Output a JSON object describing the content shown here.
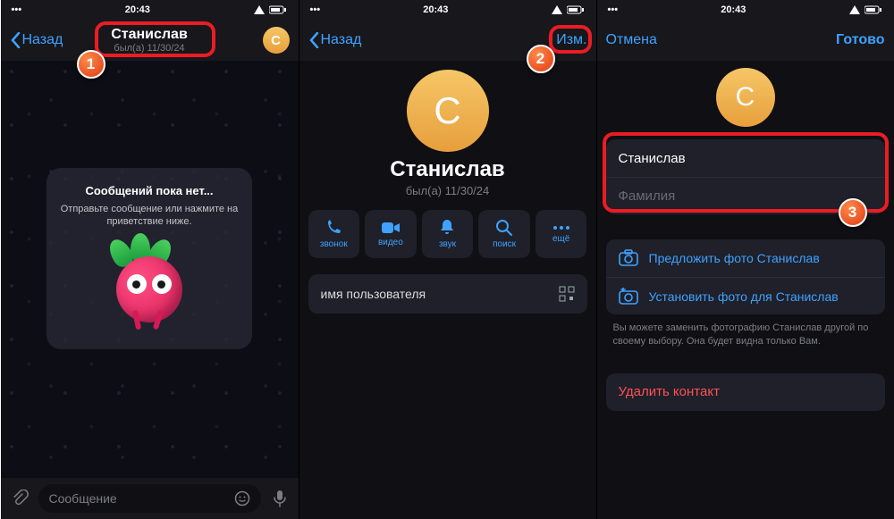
{
  "status": {
    "time": "20:43"
  },
  "colors": {
    "accent": "#3fa2ff",
    "danger": "#ff5157",
    "callout": "#ec1c24"
  },
  "screen1": {
    "nav": {
      "back": "Назад",
      "name": "Станислав",
      "sub": "был(а) 11/30/24",
      "avatar_letter": "C"
    },
    "empty": {
      "title": "Сообщений пока нет...",
      "body": "Отправьте сообщение или нажмите на приветствие ниже."
    },
    "input": {
      "placeholder": "Сообщение"
    }
  },
  "screen2": {
    "nav": {
      "back": "Назад",
      "edit": "Изм."
    },
    "avatar_letter": "C",
    "name": "Станислав",
    "sub": "был(а) 11/30/24",
    "actions": {
      "call": "звонок",
      "video": "видео",
      "mute": "звук",
      "search": "поиск",
      "more": "ещё"
    },
    "username_label": "имя пользователя"
  },
  "screen3": {
    "nav": {
      "cancel": "Отмена",
      "done": "Готово"
    },
    "avatar_letter": "C",
    "first_name": "Станислав",
    "last_name_placeholder": "Фамилия",
    "suggest_photo": "Предложить фото Станислав",
    "set_photo": "Установить фото для Станислав",
    "help": "Вы можете заменить фотографию Станислав другой по своему выбору. Она будет видна только Вам.",
    "delete": "Удалить контакт"
  },
  "badges": {
    "n1": "1",
    "n2": "2",
    "n3": "3"
  }
}
